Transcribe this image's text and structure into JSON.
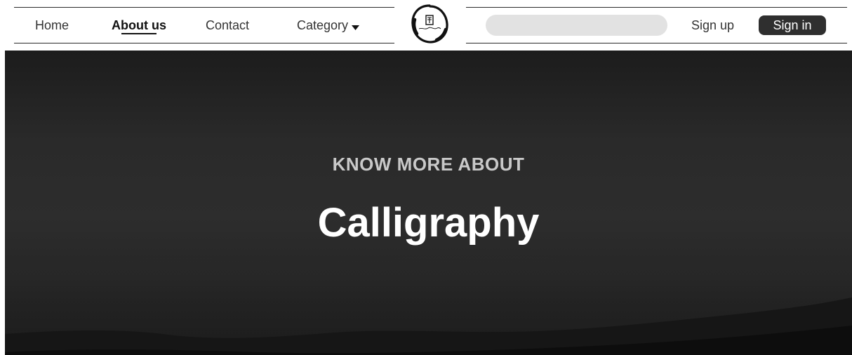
{
  "nav": {
    "items": [
      {
        "label": "Home"
      },
      {
        "label": "About us"
      },
      {
        "label": "Contact"
      },
      {
        "label": "Category"
      }
    ],
    "logo_text": "Calligraphy",
    "search": {
      "value": "",
      "placeholder": ""
    },
    "signup_label": "Sign up",
    "signin_label": "Sign in"
  },
  "hero": {
    "kicker": "KNOW MORE ABOUT",
    "title": "Calligraphy"
  }
}
